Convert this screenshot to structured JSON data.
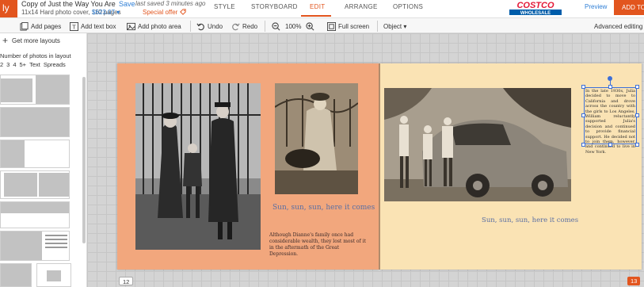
{
  "header": {
    "logo_fragment": "ly",
    "project_title": "Copy of Just the Way You Are",
    "save_label": "Save",
    "saved_status": "last saved 3 minutes ago",
    "book_specs": "11x14 Hard photo cover, 110 pages",
    "price": "$623.07 ▾",
    "special_offer": "Special offer",
    "tabs": [
      {
        "label": "STYLE"
      },
      {
        "label": "STORYBOARD"
      },
      {
        "label": "EDIT"
      },
      {
        "label": "ARRANGE"
      },
      {
        "label": "OPTIONS"
      }
    ],
    "active_tab": "EDIT",
    "brand_name": "COSTCO",
    "brand_sub": "WHOLESALE",
    "preview_label": "Preview",
    "add_to_label": "ADD TO"
  },
  "toolbar": {
    "add_pages": "Add pages",
    "add_text_box": "Add text box",
    "add_photo_area": "Add photo area",
    "undo": "Undo",
    "redo": "Redo",
    "zoom": "100%",
    "full_screen": "Full screen",
    "object": "Object ▾",
    "advanced_editing": "Advanced editing"
  },
  "left_panel": {
    "get_more_layouts": "Get more layouts",
    "number_of_photos_label": "Number of photos in layout",
    "photo_count_tabs": [
      "2",
      "3",
      "4",
      "5+",
      "Text",
      "Spreads"
    ]
  },
  "spread": {
    "left_caption": "Sun, sun, sun, here it comes",
    "left_body": "Although Dianne's family once had considerable wealth, they lost most of it in the aftermath of the Great Depression.",
    "right_caption": "Sun, sun, sun, here it comes",
    "textbox_text": "In the late 1930s, Julia decided to move to California and drove across the country with the girls to Los Angeles. William reluctantly supported Julia's decision and continued to provide financial support. He decided not to join them, however, and continued to live in New York.",
    "left_page_number": "12",
    "right_page_number": "13"
  },
  "colors": {
    "accent": "#e2551e",
    "link": "#2f7fd6",
    "left_page_bg": "#f2a77d",
    "right_page_bg": "#fae3b4",
    "caption": "#5a6fa3",
    "selection": "#3c6fd8"
  }
}
